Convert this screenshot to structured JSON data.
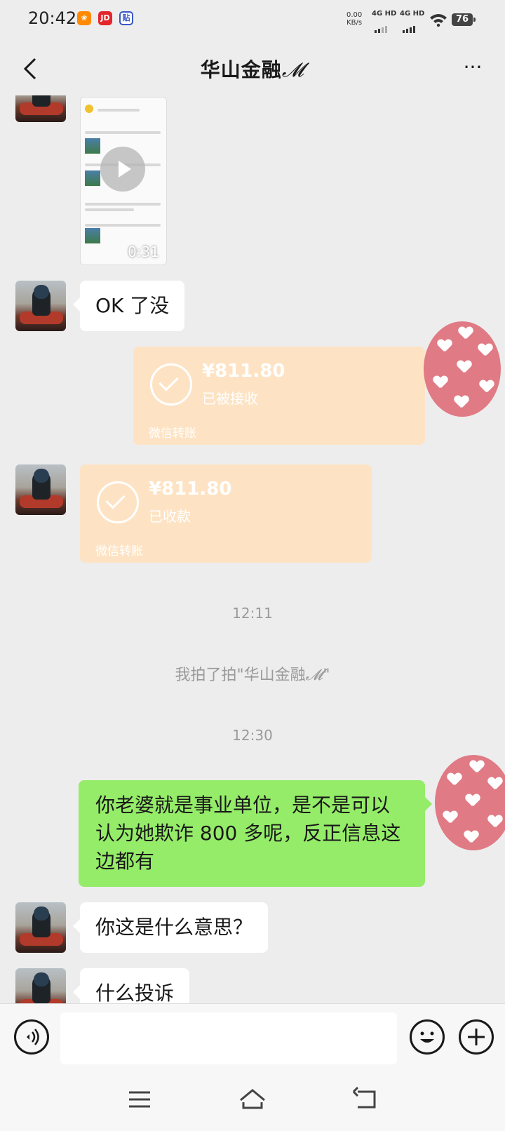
{
  "status_bar": {
    "time": "20:42",
    "icons": [
      "kuaishou-icon",
      "jd-icon",
      "tieba-icon"
    ],
    "net_speed_value": "0.00",
    "net_speed_unit": "KB/s",
    "signal_1": "4G HD",
    "signal_2": "4G HD",
    "battery": "76"
  },
  "header": {
    "title": "华山金融",
    "title_suffix": "𝓜",
    "back_icon": "chevron-left-icon",
    "more_icon": "more-dots-icon",
    "more_label": "···"
  },
  "messages": {
    "video_duration": "0:31",
    "msg_ok": "OK 了没",
    "transfer_sent": {
      "amount": "¥811.80",
      "status": "已被接收",
      "footer": "微信转账"
    },
    "transfer_received": {
      "amount": "¥811.80",
      "status": "已收款",
      "footer": "微信转账"
    },
    "time_1": "12:11",
    "pat_message": "我拍了拍\"华山金融",
    "pat_suffix_m": "𝓜",
    "pat_end": "\"",
    "time_2": "12:30",
    "msg_green": "你老婆就是事业单位，是不是可以认为她欺诈 800 多呢，反正信息这边都有",
    "msg_meaning": "你这是什么意思？",
    "msg_complaint": "什么投诉"
  },
  "input_bar": {
    "voice_icon": "voice-icon",
    "emoji_icon": "emoji-icon",
    "plus_icon": "plus-icon",
    "placeholder": ""
  },
  "nav_bar": {
    "menu_icon": "menu-icon",
    "home_icon": "home-icon",
    "back_icon": "back-icon"
  },
  "colors": {
    "background": "#ededed",
    "green_bubble": "#95ec69",
    "transfer_card": "#fde3c4",
    "self_avatar": "#e07a84"
  }
}
